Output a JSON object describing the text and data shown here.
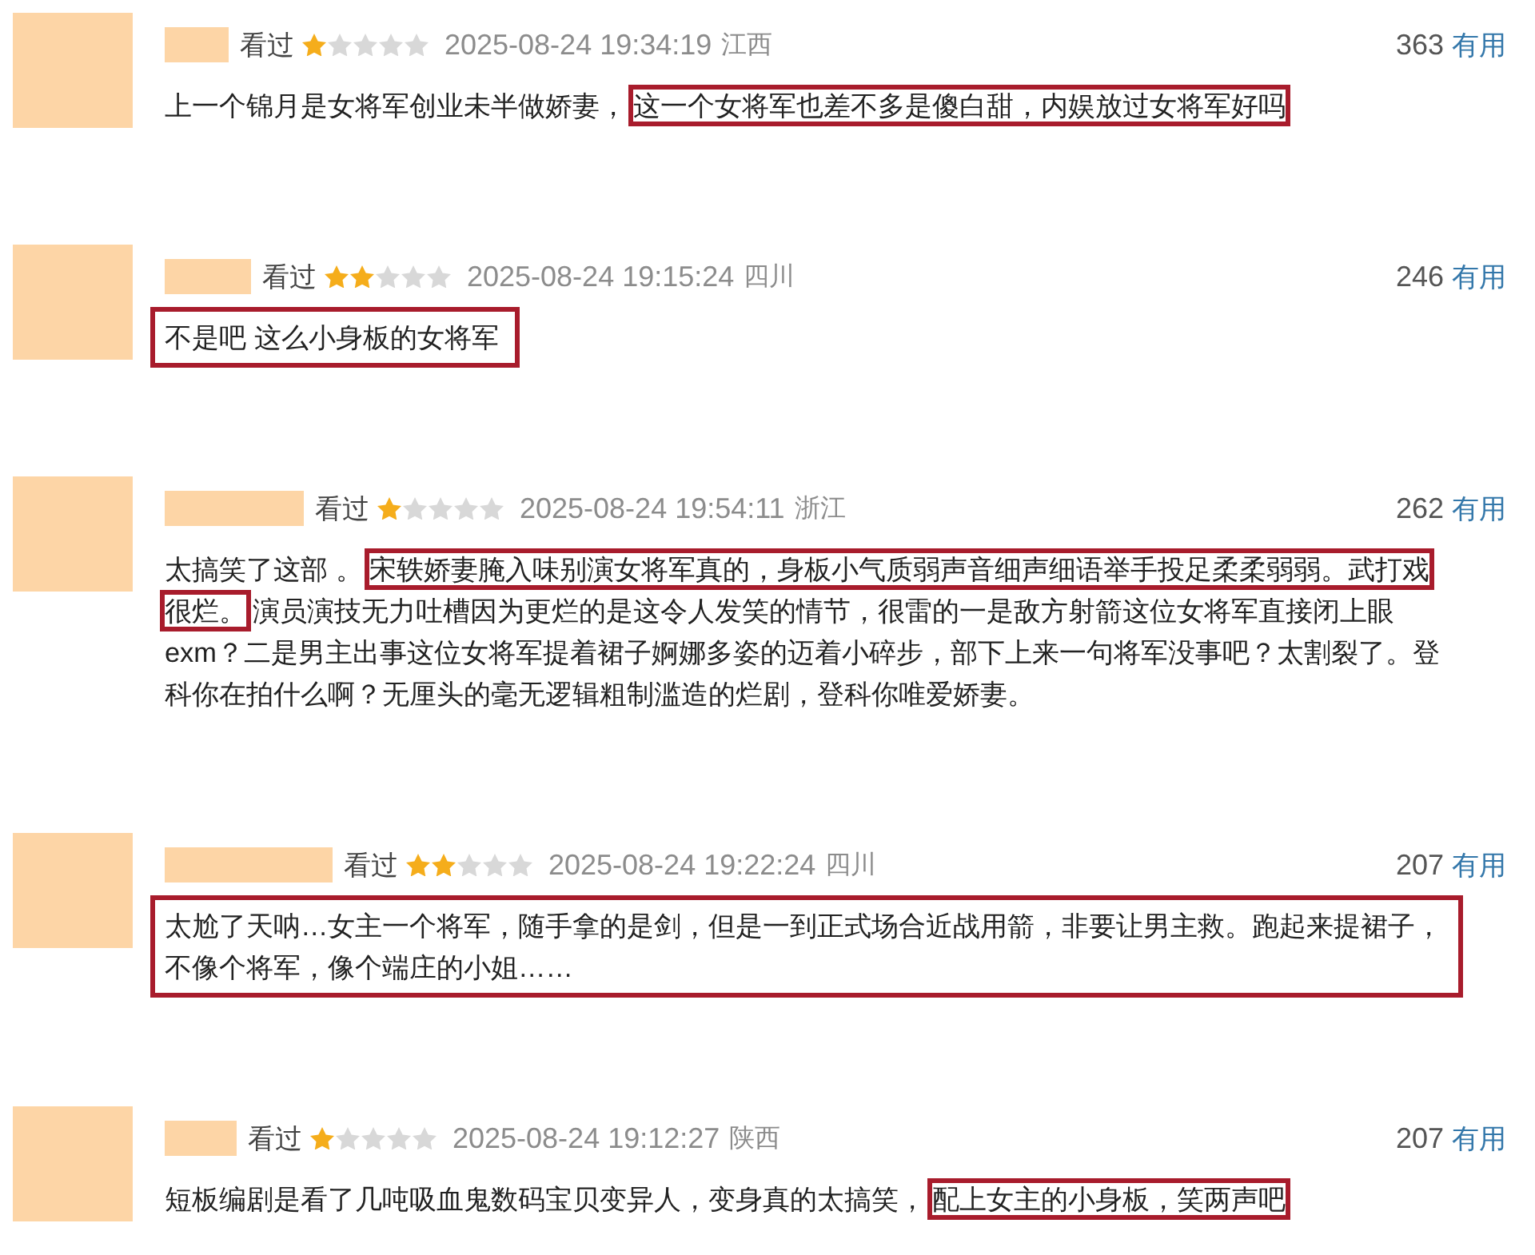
{
  "reviews": [
    {
      "status": "看过",
      "stars": 1,
      "date": "2025-08-24 19:34:19",
      "region": "江西",
      "votes": "363",
      "vote_label": "有用",
      "comment": {
        "boxed": false,
        "lines": [
          {
            "segments": [
              {
                "text": "上一个锦月是女将军创业未半做娇妻，",
                "highlighted": false
              },
              {
                "text": "这一个女将军也差不多是傻白甜，内娱放过女将军好吗",
                "highlighted": true
              }
            ]
          }
        ]
      }
    },
    {
      "status": "看过",
      "stars": 2,
      "date": "2025-08-24 19:15:24",
      "region": "四川",
      "votes": "246",
      "vote_label": "有用",
      "comment": {
        "boxed": true,
        "lines": [
          {
            "segments": [
              {
                "text": "不是吧 这么小身板的女将军",
                "highlighted": false
              }
            ]
          }
        ]
      }
    },
    {
      "status": "看过",
      "stars": 1,
      "date": "2025-08-24 19:54:11",
      "region": "浙江",
      "votes": "262",
      "vote_label": "有用",
      "comment": {
        "boxed": false,
        "lines": [
          {
            "segments": [
              {
                "text": "太搞笑了这部 。",
                "highlighted": false
              },
              {
                "text": "宋轶娇妻腌入味别演女将军真的，身板小气质弱声音细声细语举手投足柔柔弱弱。武打戏",
                "highlighted": true
              }
            ]
          },
          {
            "segments": [
              {
                "text": "很烂。",
                "highlighted": true
              },
              {
                "text": "演员演技无力吐槽因为更烂的是这令人发笑的情节，很雷的一是敌方射箭这位女将军直接闭上眼",
                "highlighted": false
              }
            ]
          },
          {
            "segments": [
              {
                "text": "exm？二是男主出事这位女将军提着裙子婀娜多姿的迈着小碎步，部下上来一句将军没事吧？太割裂了。登",
                "highlighted": false
              }
            ]
          },
          {
            "segments": [
              {
                "text": "科你在拍什么啊？无厘头的毫无逻辑粗制滥造的烂剧，登科你唯爱娇妻。",
                "highlighted": false
              }
            ]
          }
        ]
      }
    },
    {
      "status": "看过",
      "stars": 2,
      "date": "2025-08-24 19:22:24",
      "region": "四川",
      "votes": "207",
      "vote_label": "有用",
      "comment": {
        "boxed": true,
        "lines": [
          {
            "segments": [
              {
                "text": "太尬了天呐…女主一个将军，随手拿的是剑，但是一到正式场合近战用箭，非要让男主救。跑起来提裙子，",
                "highlighted": false
              }
            ]
          },
          {
            "segments": [
              {
                "text": "不像个将军，像个端庄的小姐……",
                "highlighted": false
              }
            ]
          }
        ]
      }
    },
    {
      "status": "看过",
      "stars": 1,
      "date": "2025-08-24 19:12:27",
      "region": "陕西",
      "votes": "207",
      "vote_label": "有用",
      "comment": {
        "boxed": false,
        "lines": [
          {
            "segments": [
              {
                "text": "短板编剧是看了几吨吸血鬼数码宝贝变异人，变身真的太搞笑，",
                "highlighted": false
              },
              {
                "text": "配上女主的小身板，笑两声吧",
                "highlighted": true
              }
            ]
          }
        ]
      }
    }
  ]
}
